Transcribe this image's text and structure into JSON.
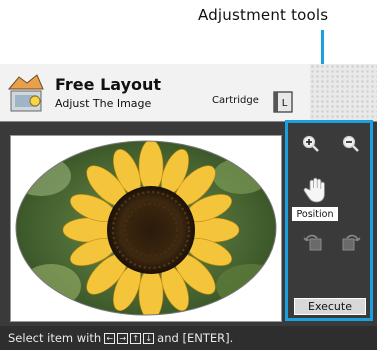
{
  "callout": {
    "label": "Adjustment tools"
  },
  "header": {
    "title": "Free Layout",
    "subtitle": "Adjust The Image",
    "cartridge_label": "Cartridge",
    "cartridge_icon_letter": "L"
  },
  "photo": {
    "subject": "sunflower"
  },
  "panel": {
    "zoom_in_icon": "magnifier-plus",
    "zoom_out_icon": "magnifier-minus",
    "position_icon": "hand",
    "position_label": "Position",
    "rotate_left_icon": "rotate-left",
    "rotate_right_icon": "rotate-right",
    "execute_label": "Execute"
  },
  "status": {
    "prefix": "Select item with",
    "keys": [
      "←",
      "→",
      "↑",
      "↓"
    ],
    "suffix": "and [ENTER]."
  },
  "colors": {
    "accent": "#1aa0e0",
    "screen_bg": "#3a3a3a"
  }
}
